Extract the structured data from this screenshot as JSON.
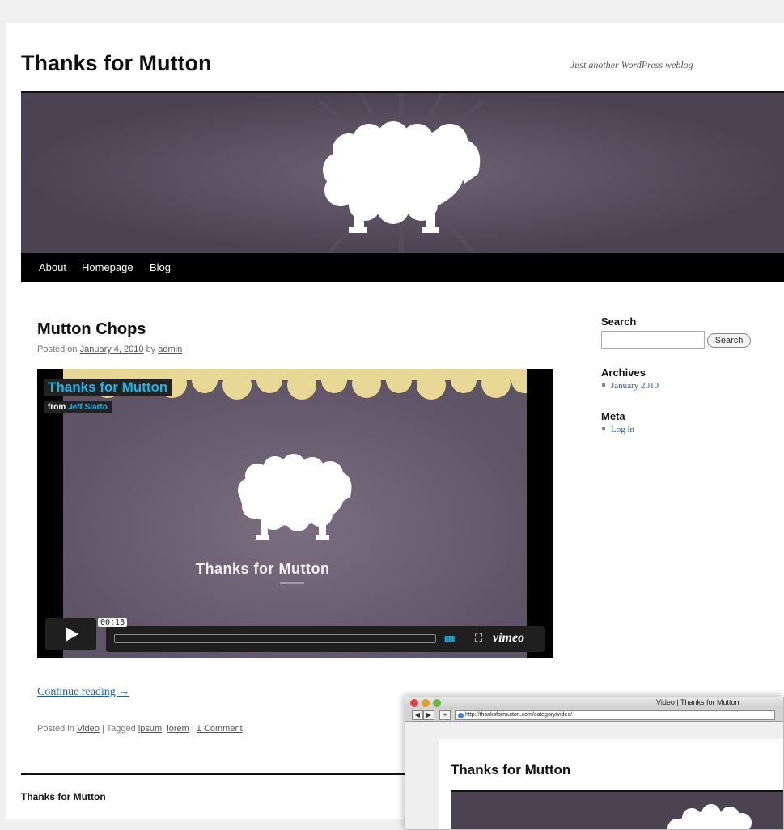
{
  "site": {
    "title": "Thanks for Mutton",
    "tagline": "Just another WordPress weblog"
  },
  "nav": {
    "items": [
      "About",
      "Homepage",
      "Blog"
    ]
  },
  "post": {
    "title": "Mutton Chops",
    "posted_on_label": "Posted on",
    "date": "January 4, 2010",
    "by_label": "by",
    "author": "admin",
    "continue_reading": "Continue reading →",
    "posted_in_label": "Posted in",
    "category": "Video",
    "tagged_label": "| Tagged",
    "tags": [
      "ipsum",
      "lorem"
    ],
    "tag_separator": ",",
    "comments_separator": "|",
    "comments": "1 Comment"
  },
  "video": {
    "title": "Thanks for Mutton",
    "from_label": "from",
    "author": "Jeff Siarto",
    "caption": "Thanks for Mutton",
    "timecode": "00:18",
    "volume_bars": "IIIIIII",
    "fullscreen_icon": "fullscreen-icon",
    "brand": "vimeo",
    "colors": {
      "accent": "#1ab7ea",
      "background": "#5f5366"
    }
  },
  "sidebar": {
    "search": {
      "title": "Search",
      "button": "Search",
      "value": ""
    },
    "archives": {
      "title": "Archives",
      "items": [
        "January 2010"
      ]
    },
    "meta": {
      "title": "Meta",
      "items": [
        "Log in"
      ]
    }
  },
  "footer": {
    "title": "Thanks for Mutton"
  },
  "browser": {
    "window_title": "Video | Thanks for Mutton",
    "url": "http://thanksformutton.com/category/video/",
    "back_label": "◀",
    "forward_label": "▶",
    "add_label": "+",
    "site_title": "Thanks for Mutton"
  },
  "colors": {
    "banner": "#4b4252",
    "link": "#1b5ea7",
    "nav_bg": "#000000"
  }
}
